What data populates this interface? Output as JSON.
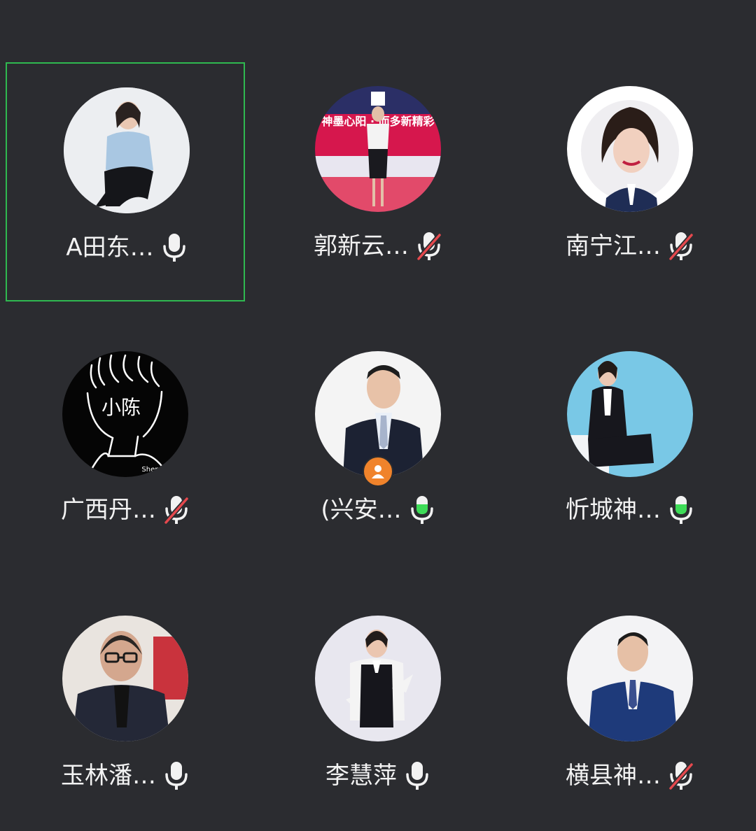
{
  "participants": [
    {
      "name": "A田东…",
      "mic": "on",
      "active": true
    },
    {
      "name": "郭新云…",
      "mic": "muted"
    },
    {
      "name": "南宁江…",
      "mic": "muted"
    },
    {
      "name": "广西丹…",
      "mic": "muted"
    },
    {
      "name": "(兴安…",
      "mic": "speaking",
      "host": true
    },
    {
      "name": "忻城神…",
      "mic": "speaking"
    },
    {
      "name": "玉林潘…",
      "mic": "on"
    },
    {
      "name": "李慧萍",
      "mic": "on"
    },
    {
      "name": "横县神…",
      "mic": "muted"
    }
  ],
  "banner_text": "神墨心阳 · 而多新精彩",
  "avatar_sketch_text": "小陈",
  "avatar_sketch_caption": "Shen",
  "colors": {
    "background": "#2b2c30",
    "active_border": "#2fb950",
    "speaking_green": "#3ddc57",
    "muted_red": "#e5484d",
    "host_badge": "#f0832b"
  },
  "icons": {
    "mic_on": "microphone-icon",
    "mic_muted": "microphone-muted-icon",
    "mic_speaking": "microphone-speaking-icon",
    "host": "person-icon"
  }
}
